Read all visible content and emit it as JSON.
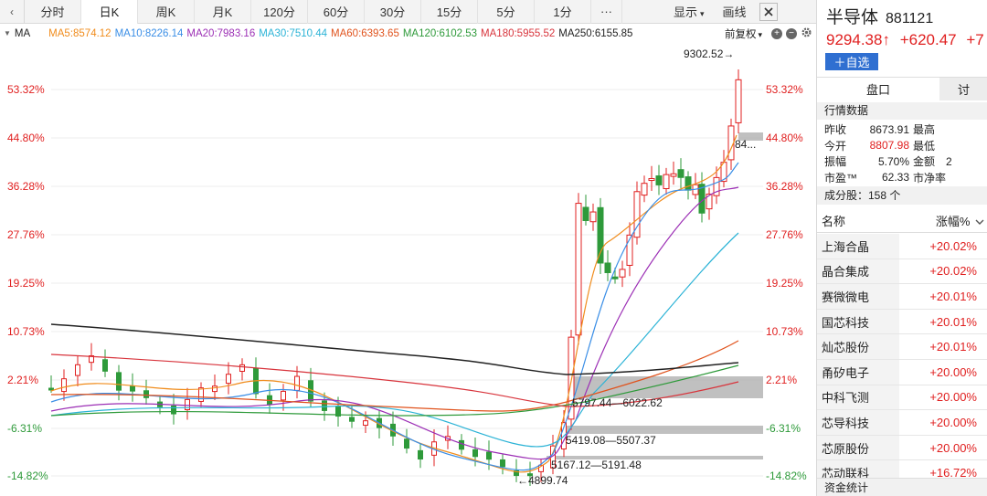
{
  "toolbar": {
    "left_button": "‹",
    "periods": [
      {
        "label": "分时",
        "active": false
      },
      {
        "label": "日K",
        "active": true
      },
      {
        "label": "周K",
        "active": false
      },
      {
        "label": "月K",
        "active": false
      },
      {
        "label": "120分",
        "active": false
      },
      {
        "label": "60分",
        "active": false
      },
      {
        "label": "30分",
        "active": false
      },
      {
        "label": "15分",
        "active": false
      },
      {
        "label": "5分",
        "active": false
      },
      {
        "label": "1分",
        "active": false
      }
    ],
    "more": "···",
    "display_label": "显示",
    "display_caret": "▾",
    "draw_label": "画线",
    "close_icon": "close-icon"
  },
  "ma_row": {
    "indicator": "MA",
    "caret": "▼",
    "items": [
      {
        "label": "MA5:8574.12",
        "color": "#f08c1c"
      },
      {
        "label": "MA10:8226.14",
        "color": "#3a8ee6"
      },
      {
        "label": "MA20:7983.16",
        "color": "#9c2fb5"
      },
      {
        "label": "MA30:7510.44",
        "color": "#2bb3d6"
      },
      {
        "label": "MA60:6393.65",
        "color": "#e0531d"
      },
      {
        "label": "MA120:6102.53",
        "color": "#2e9a3a"
      },
      {
        "label": "MA180:5955.52",
        "color": "#d8343c"
      },
      {
        "label": "MA250:6155.85",
        "color": "#222222"
      }
    ],
    "adjust_label": "前复权",
    "adjust_caret": "▾",
    "icons": [
      "plus-icon",
      "minus-icon",
      "gear-icon"
    ]
  },
  "chart_data": {
    "type": "candlestick",
    "y_axis_left": [
      "53.32%",
      "44.80%",
      "36.28%",
      "27.76%",
      "19.25%",
      "10.73%",
      "2.21%",
      "-6.31%",
      "-14.82%"
    ],
    "y_axis_right": [
      "53.32%",
      "44.80%",
      "36.28%",
      "27.76%",
      "19.25%",
      "10.73%",
      "2.21%",
      "-6.31%",
      "-14.82%"
    ],
    "ylim_percent": [
      -14.82,
      53.32
    ],
    "annotations": [
      {
        "label": "9302.52→",
        "kind": "max_high"
      },
      {
        "label": "84...",
        "kind": "zone_label"
      },
      {
        "label": "5797.44—6022.62",
        "kind": "gap_zone"
      },
      {
        "label": "5419.08—5507.37",
        "kind": "gap_zone"
      },
      {
        "label": "5167.12—5191.48",
        "kind": "gap_zone"
      },
      {
        "label": "←4899.74",
        "kind": "min_low"
      }
    ],
    "colors": {
      "up": "#e02020",
      "down": "#2e9a3a",
      "axis_up": "#e02020",
      "axis_down": "#2e9a3a",
      "gap_zone": "#b5b5b5"
    }
  },
  "panel": {
    "name": "半导体",
    "code": "881121",
    "price": "9294.38↑",
    "change": "+620.47",
    "change_pct": "+7",
    "add_button": "＋自选",
    "tabs": [
      "盘口",
      "讨"
    ],
    "quote_title": "行情数据",
    "quote_rows": [
      {
        "k1": "昨收",
        "v1": "8673.91",
        "k2": "最高",
        "v2": "",
        "v1_color": "#222222"
      },
      {
        "k1": "今开",
        "v1": "8807.98",
        "k2": "最低",
        "v2": "",
        "v1_color": "#e02020"
      },
      {
        "k1": "振幅",
        "v1": "5.70%",
        "k2": "金额",
        "v2": "2",
        "v1_color": "#222222"
      },
      {
        "k1": "市盈™",
        "v1": "62.33",
        "k2": "市净率",
        "v2": "",
        "v1_color": "#222222"
      }
    ],
    "components_title": "成分股：158 个",
    "list_header": {
      "name": "名称",
      "change": "涨幅%",
      "sort_icon": "chevron-down-icon"
    },
    "list": [
      {
        "name": "上海合晶",
        "change": "+20.02%"
      },
      {
        "name": "晶合集成",
        "change": "+20.02%"
      },
      {
        "name": "赛微微电",
        "change": "+20.01%"
      },
      {
        "name": "国芯科技",
        "change": "+20.01%"
      },
      {
        "name": "灿芯股份",
        "change": "+20.01%"
      },
      {
        "name": "甬矽电子",
        "change": "+20.00%"
      },
      {
        "name": "中科飞测",
        "change": "+20.00%"
      },
      {
        "name": "芯导科技",
        "change": "+20.00%"
      },
      {
        "name": "芯原股份",
        "change": "+20.00%"
      },
      {
        "name": "芯动联科",
        "change": "+16.72%"
      }
    ],
    "fund_title": "资金统计"
  }
}
